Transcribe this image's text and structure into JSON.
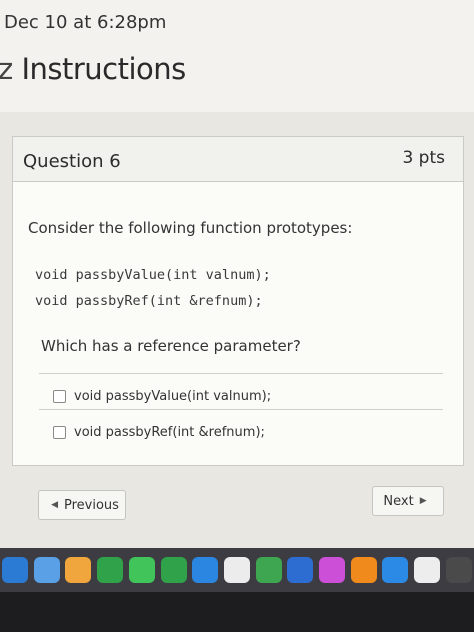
{
  "header": {
    "due_text": "Dec 10 at 6:28pm",
    "instructions_prefix": "z",
    "instructions_label": "Instructions"
  },
  "question": {
    "title": "Question 6",
    "points": "3 pts",
    "intro": "Consider the following function prototypes:",
    "code_line_1": "void passbyValue(int valnum);",
    "code_line_2": "void passbyRef(int &refnum);",
    "prompt": "Which has a reference parameter?",
    "answers": [
      {
        "label": "void passbyValue(int valnum);"
      },
      {
        "label": "void passbyRef(int &refnum);"
      }
    ]
  },
  "navigation": {
    "previous_label": "Previous",
    "next_label": "Next"
  },
  "dock": {
    "icons": [
      "finder-icon",
      "mail-icon",
      "photos-icon",
      "chrome-icon",
      "messages-icon",
      "facetime-icon",
      "safari-icon",
      "calendar-icon",
      "numbers-icon",
      "keynote-icon",
      "itunes-icon",
      "books-icon",
      "app-store-icon",
      "preview-icon",
      "system-icon"
    ],
    "colors": [
      "#2b7bd4",
      "#5aa0e6",
      "#f0a63c",
      "#2fa24a",
      "#41c45a",
      "#2fa24a",
      "#2a86e0",
      "#ececec",
      "#3ea650",
      "#2d6cd0",
      "#cc4fd8",
      "#f08a1d",
      "#2b8ae6",
      "#ededed",
      "#4a4a4a"
    ]
  }
}
